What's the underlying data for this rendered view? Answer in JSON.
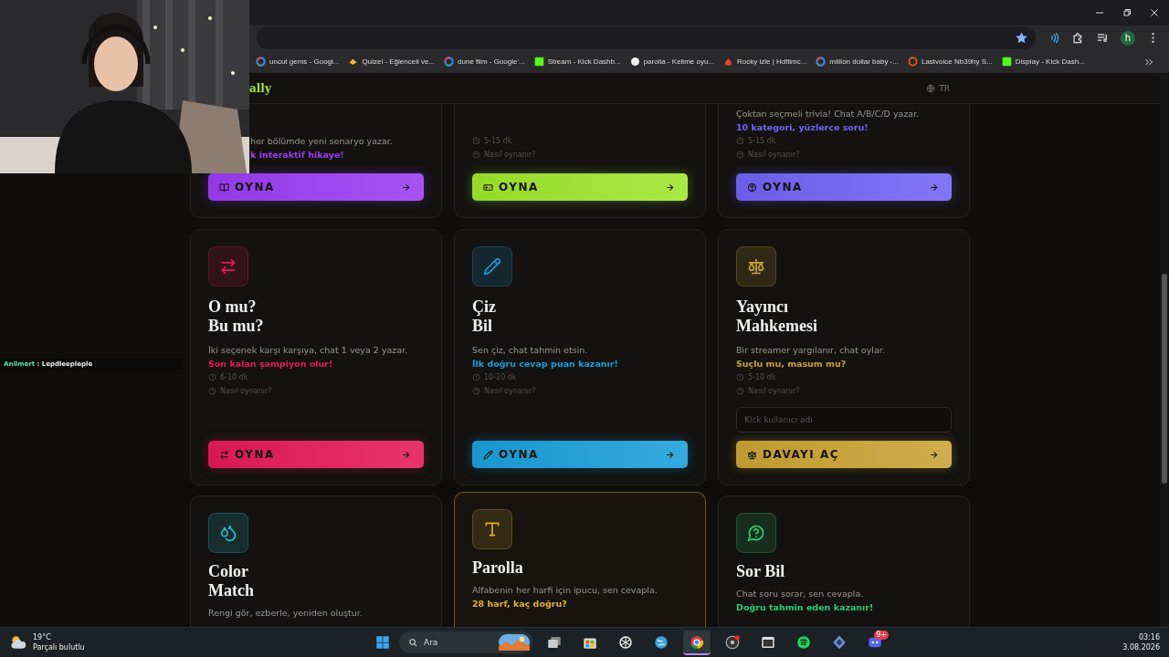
{
  "browser": {
    "bookmarks": [
      {
        "kind": "google",
        "title": "uncut gems - Googl..."
      },
      {
        "kind": "quiz",
        "title": "Quizei - Eğlenceli ve..."
      },
      {
        "kind": "google",
        "title": "dune film - Google'..."
      },
      {
        "kind": "kick",
        "title": "Stream - Kick Dashb..."
      },
      {
        "kind": "circle",
        "title": "parolla - Kelime oyu..."
      },
      {
        "kind": "rocky",
        "title": "Rocky izle | Hdfilmc..."
      },
      {
        "kind": "google",
        "title": "million dollar baby -..."
      },
      {
        "kind": "lastvoice",
        "title": "Lastvoice Nb39hy S..."
      },
      {
        "kind": "kick",
        "title": "Display - Kick Dash..."
      }
    ],
    "profile": "h"
  },
  "site": {
    "logo": "ally",
    "language": "TR"
  },
  "card_rows": [
    [
      {
        "kind": "book",
        "desc": "her bölümde yeni senaryo yazar.",
        "highlight": "k interaktif hikaye!",
        "button": "OYNA",
        "color": "#9b3cf2",
        "hovered": false
      },
      {
        "kind": "gamepad",
        "duration": "5-15 dk",
        "howto": "Nasıl oynanır?",
        "button": "OYNA",
        "color": "#9fe52b",
        "hovered": false
      },
      {
        "kind": "brain",
        "desc": "Çoktan seçmeli trivia! Chat A/B/C/D yazar.",
        "highlight": "10 kategori, yüzlerce soru!",
        "duration": "5-15 dk",
        "howto": "Nasıl oynanır?",
        "button": "OYNA",
        "color": "#7262f5",
        "hovered": false
      }
    ],
    [
      {
        "kind": "swap",
        "title": "O mu?\nBu mu?",
        "desc": "İki seçenek karşı karşıya, chat 1 veya 2 yazar.",
        "highlight": "Son kalan şampiyon olur!",
        "duration": "6-10 dk",
        "howto": "Nasıl oynanır?",
        "button": "OYNA",
        "color": "#e3195b",
        "hovered": false
      },
      {
        "kind": "pencil",
        "title": "Çiz\nBil",
        "desc": "Sen çiz, chat tahmin etsin.",
        "highlight": "İlk doğru cevap puan kazanır!",
        "duration": "10-20 dk",
        "howto": "Nasıl oynanır?",
        "button": "OYNA",
        "color": "#1a9ed8",
        "hovered": false
      },
      {
        "kind": "scale",
        "title": "Yayıncı\nMahkemesi",
        "desc": "Bir streamer yargılanır, chat oylar.",
        "highlight": "Suçlu mu, masum mu?",
        "duration": "5-10 dk",
        "howto": "Nasıl oynanır?",
        "input_placeholder": "Kick kullanıcı adı",
        "button": "DAVAYI AÇ",
        "color": "#c9a232",
        "hovered": false
      }
    ],
    [
      {
        "kind": "drops",
        "title": "Color\nMatch",
        "desc": "Rengi gör, ezberle, yeniden oluştur.",
        "color": "#2bbfd0",
        "hovered": false
      },
      {
        "kind": "type",
        "title": "Parolla",
        "desc": "Alfabenin her harfi için ipucu, sen cevapla.",
        "highlight": "28 harf, kaç doğru?",
        "color": "#e5b027",
        "hovered": true
      },
      {
        "kind": "question",
        "title": "Sor Bil",
        "desc": "Chat soru sorar, sen cevapla.",
        "highlight": "Doğru tahmin eden kazanır!",
        "color": "#2ecc71",
        "hovered": false
      }
    ]
  ],
  "chat": {
    "user": "Anilmert",
    "message": ": Lepdleepleple"
  },
  "taskbar": {
    "weather": {
      "temp": "19°C",
      "desc": "Parçalı bulutlu"
    },
    "search": {
      "placeholder": "Ara"
    },
    "apps": [
      {
        "kind": "taskview",
        "active": false
      },
      {
        "kind": "store",
        "active": false
      },
      {
        "kind": "knot",
        "active": false
      },
      {
        "kind": "globe",
        "active": false
      },
      {
        "kind": "browser",
        "active": true
      },
      {
        "kind": "record",
        "active": false
      },
      {
        "kind": "terminal",
        "active": false
      },
      {
        "kind": "music",
        "active": false
      },
      {
        "kind": "cube",
        "active": false
      },
      {
        "kind": "chat",
        "active": false,
        "badge": "9+"
      }
    ],
    "time": "03:16",
    "date": "3.08.2026"
  }
}
